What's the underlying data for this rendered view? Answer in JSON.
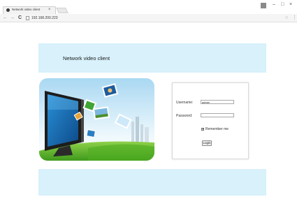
{
  "browser": {
    "tab_title": "Network video client",
    "tab_close": "×",
    "url": "192.168.200.223",
    "nav": {
      "back": "←",
      "forward": "→",
      "reload": "C"
    },
    "window_controls": {
      "minimize": "–",
      "maximize": "□",
      "close": "×"
    }
  },
  "page": {
    "header_title": "Network video client"
  },
  "login": {
    "username_label": "Username:",
    "username_value": "admin",
    "password_label": "Password:",
    "password_value": "",
    "remember_label": "Remember me",
    "remember_checked": true,
    "login_button": "Login"
  },
  "colors": {
    "band": "#d8f1fb",
    "sky_top": "#bde3f7",
    "grass": "#6cbf2e"
  }
}
